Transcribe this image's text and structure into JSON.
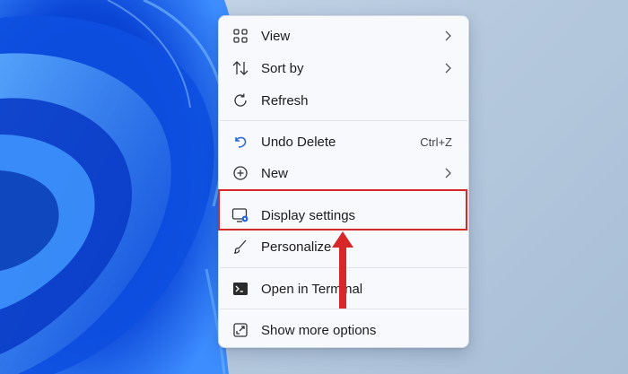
{
  "menu": {
    "items": [
      {
        "label": "View",
        "icon": "grid-view-icon",
        "submenu": true
      },
      {
        "label": "Sort by",
        "icon": "sort-arrows-icon",
        "submenu": true
      },
      {
        "label": "Refresh",
        "icon": "refresh-icon"
      },
      {
        "label": "Undo Delete",
        "icon": "undo-icon",
        "shortcut": "Ctrl+Z"
      },
      {
        "label": "New",
        "icon": "plus-circle-icon",
        "submenu": true
      },
      {
        "label": "Display settings",
        "icon": "display-settings-icon"
      },
      {
        "label": "Personalize",
        "icon": "brush-icon"
      },
      {
        "label": "Open in Terminal",
        "icon": "terminal-icon"
      },
      {
        "label": "Show more options",
        "icon": "show-more-icon"
      }
    ]
  },
  "annotation": {
    "highlight_color": "#d62828",
    "highlighted_item": "Display settings"
  },
  "colors": {
    "wallpaper_dark": "#0a3cc8",
    "wallpaper_light": "#4aa3ff",
    "accent": "#2563d8"
  }
}
